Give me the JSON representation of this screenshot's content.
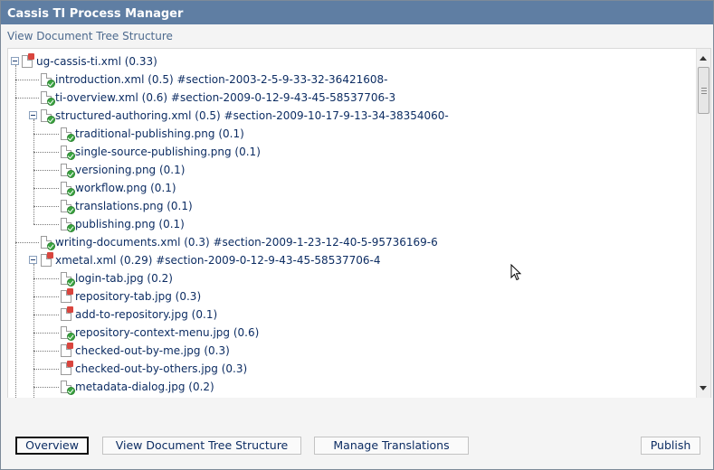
{
  "window": {
    "title": "Cassis TI Process Manager"
  },
  "page": {
    "subtitle": "View Document Tree Structure"
  },
  "tree": {
    "rows": [
      {
        "text": "ug-cassis-ti.xml (0.33)",
        "icon": "doc-red-icon",
        "level": 0,
        "toggle": "minus"
      },
      {
        "text": "introduction.xml (0.5) #section-2003-2-5-9-33-32-36421608-",
        "icon": "doc-check-icon",
        "level": 1
      },
      {
        "text": "ti-overview.xml (0.6) #section-2009-0-12-9-43-45-58537706-3",
        "icon": "doc-check-icon",
        "level": 1
      },
      {
        "text": "structured-authoring.xml (0.5) #section-2009-10-17-9-13-34-38354060-",
        "icon": "doc-check-icon",
        "level": 1,
        "toggle": "minus"
      },
      {
        "text": "traditional-publishing.png (0.1)",
        "icon": "doc-check-icon",
        "level": 2
      },
      {
        "text": "single-source-publishing.png (0.1)",
        "icon": "doc-check-icon",
        "level": 2
      },
      {
        "text": "versioning.png (0.1)",
        "icon": "doc-check-icon",
        "level": 2
      },
      {
        "text": "workflow.png (0.1)",
        "icon": "doc-check-icon",
        "level": 2
      },
      {
        "text": "translations.png (0.1)",
        "icon": "doc-check-icon",
        "level": 2
      },
      {
        "text": "publishing.png (0.1)",
        "icon": "doc-check-icon",
        "level": 2
      },
      {
        "text": "writing-documents.xml (0.3) #section-2009-1-23-12-40-5-95736169-6",
        "icon": "doc-check-icon",
        "level": 1
      },
      {
        "text": "xmetal.xml (0.29) #section-2009-0-12-9-43-45-58537706-4",
        "icon": "doc-red-icon",
        "level": 1,
        "toggle": "minus"
      },
      {
        "text": "login-tab.jpg (0.2)",
        "icon": "doc-check-icon",
        "level": 2
      },
      {
        "text": "repository-tab.jpg (0.3)",
        "icon": "doc-red-icon",
        "level": 2
      },
      {
        "text": "add-to-repository.jpg (0.1)",
        "icon": "doc-red-icon",
        "level": 2
      },
      {
        "text": "repository-context-menu.jpg (0.6)",
        "icon": "doc-check-icon",
        "level": 2
      },
      {
        "text": "checked-out-by-me.jpg (0.3)",
        "icon": "doc-red-icon",
        "level": 2
      },
      {
        "text": "checked-out-by-others.jpg (0.3)",
        "icon": "doc-red-icon",
        "level": 2
      },
      {
        "text": "metadata-dialog.jpg (0.2)",
        "icon": "doc-check-icon",
        "level": 2
      }
    ]
  },
  "buttons": {
    "overview": "Overview",
    "view_tree": "View Document Tree Structure",
    "manage_translations": "Manage Translations",
    "publish": "Publish"
  },
  "colors": {
    "titlebar": "#5f7ea3",
    "link": "#0d2d63",
    "check": "#3aa540",
    "red": "#d9453e"
  }
}
